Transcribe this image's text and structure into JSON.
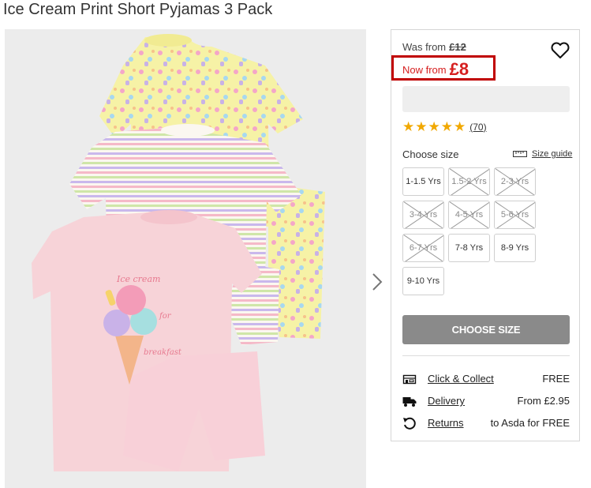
{
  "product": {
    "title": "Ice Cream Print Short Pyjamas 3 Pack"
  },
  "image": {
    "next_icon": "chevron-right-icon",
    "print_text_1": "Ice cream",
    "print_text_2": "for",
    "print_text_3": "breakfast"
  },
  "price": {
    "was_label": "Was from",
    "was_value": "£12",
    "now_label": "Now from",
    "now_value": "£8",
    "highlight_color": "#c00000",
    "price_color": "#d62020"
  },
  "wishlist": {
    "icon": "heart-outline-icon"
  },
  "rating": {
    "stars": 5,
    "count": "(70)",
    "star_color": "#f1a800"
  },
  "sizes": {
    "label": "Choose size",
    "guide_label": "Size guide",
    "guide_icon": "ruler-icon",
    "options": [
      {
        "label": "1-1.5 Yrs",
        "available": true
      },
      {
        "label": "1.5-2 Yrs",
        "available": false
      },
      {
        "label": "2-3 Yrs",
        "available": false
      },
      {
        "label": "3-4 Yrs",
        "available": false
      },
      {
        "label": "4-5 Yrs",
        "available": false
      },
      {
        "label": "5-6 Yrs",
        "available": false
      },
      {
        "label": "6-7 Yrs",
        "available": false
      },
      {
        "label": "7-8 Yrs",
        "available": true
      },
      {
        "label": "8-9 Yrs",
        "available": true
      },
      {
        "label": "9-10 Yrs",
        "available": true
      }
    ]
  },
  "cta": {
    "label": "CHOOSE SIZE",
    "color": "#8a8a8a"
  },
  "services": [
    {
      "icon": "store-icon",
      "name": "Click & Collect",
      "value": "FREE"
    },
    {
      "icon": "truck-icon",
      "name": "Delivery",
      "value": "From £2.95"
    },
    {
      "icon": "return-arrow-icon",
      "name": "Returns",
      "value": "to Asda for FREE"
    }
  ]
}
